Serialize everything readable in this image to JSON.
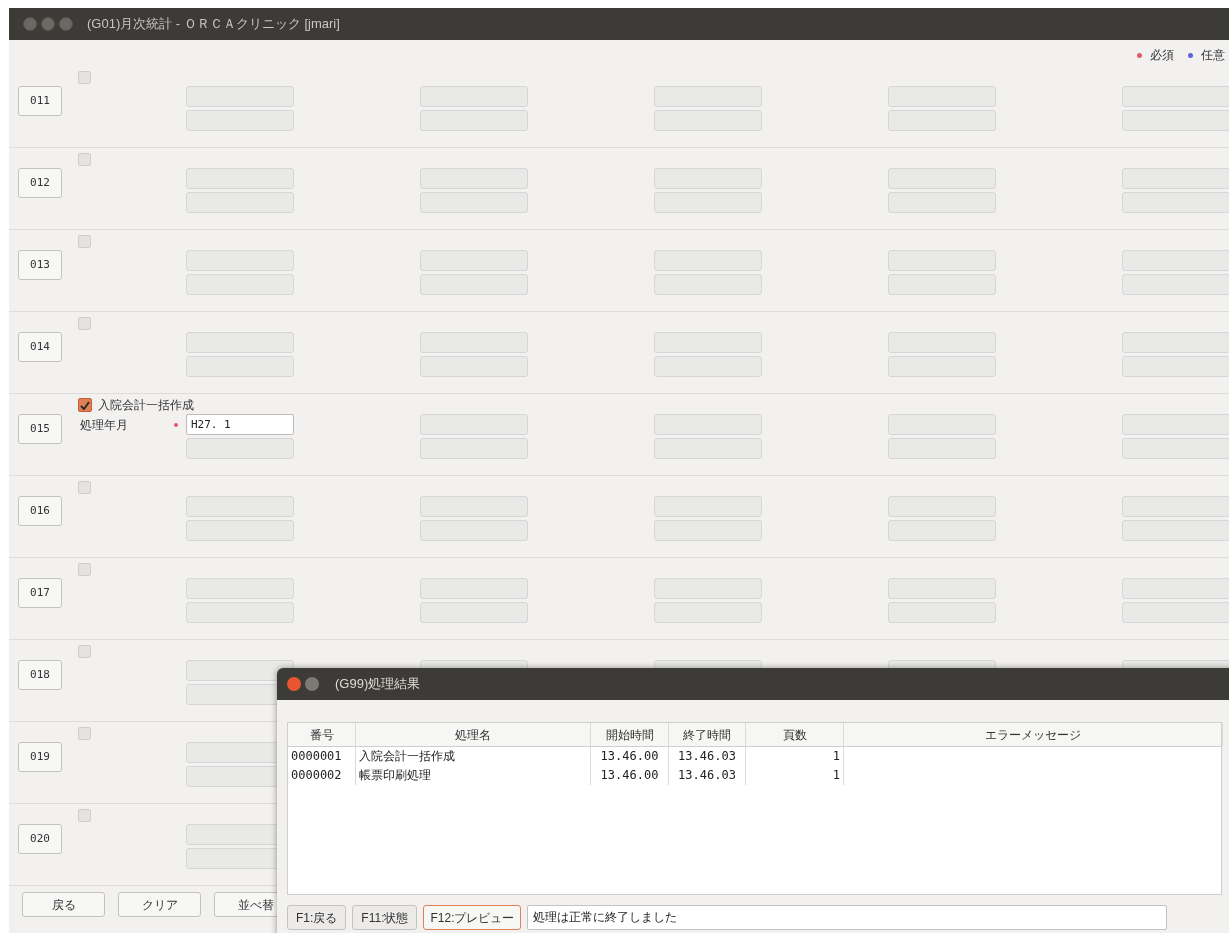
{
  "window": {
    "title": "(G01)月次統計 - ＯＲＣＡクリニック [jmari]"
  },
  "legend": [
    {
      "label": "必須",
      "color": "#e05a6a"
    },
    {
      "label": "任意",
      "color": "#5a64e0"
    }
  ],
  "rows": [
    {
      "number": "011",
      "checked": false
    },
    {
      "number": "012",
      "checked": false
    },
    {
      "number": "013",
      "checked": false
    },
    {
      "number": "014",
      "checked": false
    },
    {
      "number": "015",
      "checked": true,
      "label": "入院会計一括作成",
      "field_label": "処理年月",
      "required": true,
      "field_value": "H27. 1"
    },
    {
      "number": "016",
      "checked": false
    },
    {
      "number": "017",
      "checked": false
    },
    {
      "number": "018",
      "checked": false
    },
    {
      "number": "019",
      "checked": false
    },
    {
      "number": "020",
      "checked": false
    }
  ],
  "buttons": [
    "戻る",
    "クリア",
    "並べ替"
  ],
  "dialog": {
    "title": "(G99)処理結果",
    "table": {
      "columns": [
        "番号",
        "処理名",
        "開始時間",
        "終了時間",
        "頁数",
        "エラーメッセージ"
      ],
      "rows": [
        [
          "0000001",
          "入院会計一括作成",
          "13.46.00",
          "13.46.03",
          "1"
        ],
        [
          "0000002",
          "帳票印刷処理",
          "13.46.00",
          "13.46.03",
          "1"
        ]
      ]
    },
    "buttons": [
      {
        "label": "F1:戻る",
        "focused": false
      },
      {
        "label": "F11:状態",
        "focused": false
      },
      {
        "label": "F12:プレビュー",
        "focused": true
      }
    ],
    "message": "処理は正常に終了しました"
  }
}
